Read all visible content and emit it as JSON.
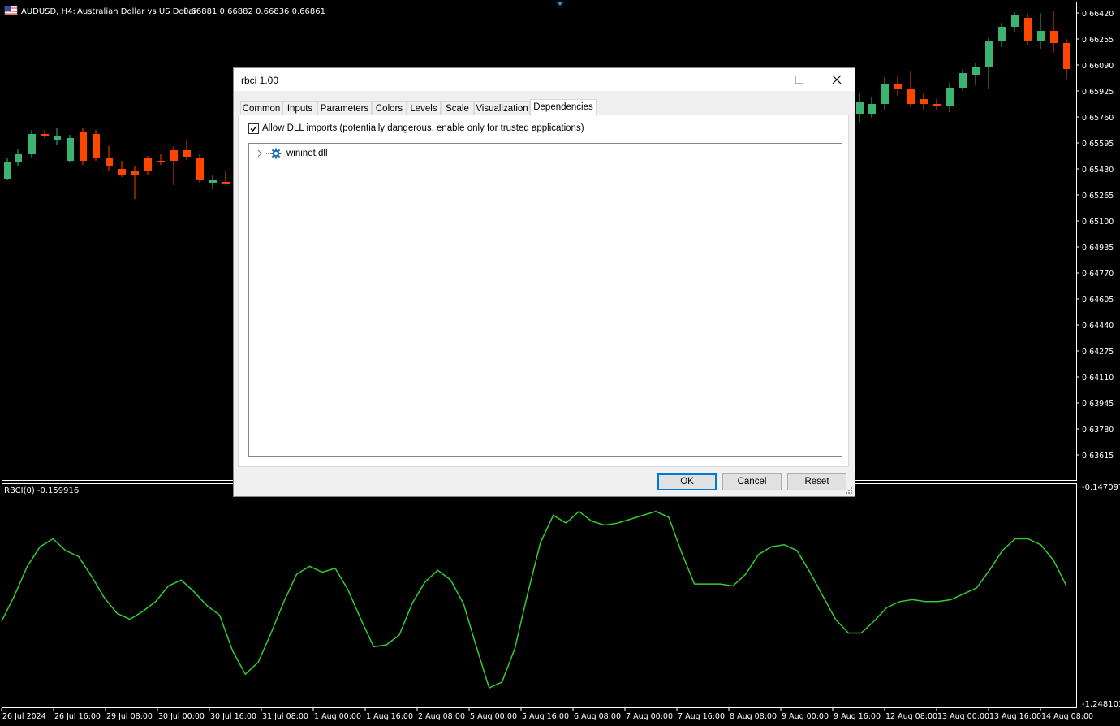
{
  "chart": {
    "header": {
      "symbol": "AUDUSD, H4:",
      "description": "Australian Dollar vs US Dollar",
      "ohlc": "0.66881 0.66882 0.66836 0.66861"
    },
    "price_axis": [
      "0.66420",
      "0.66255",
      "0.66090",
      "0.65925",
      "0.65760",
      "0.65595",
      "0.65430",
      "0.65265",
      "0.65100",
      "0.64935",
      "0.64770",
      "0.64605",
      "0.64440",
      "0.64275",
      "0.64110",
      "0.63945",
      "0.63780",
      "0.63615"
    ],
    "indicator": {
      "label": "RBCI(0) -0.159916",
      "axis_top": "-0.147097",
      "axis_bottom": "-1.248103"
    },
    "time_axis": [
      "26 Jul 2024",
      "26 Jul 16:00",
      "29 Jul 08:00",
      "30 Jul 00:00",
      "30 Jul 16:00",
      "31 Jul 08:00",
      "1 Aug 00:00",
      "1 Aug 16:00",
      "2 Aug 08:00",
      "5 Aug 00:00",
      "5 Aug 16:00",
      "6 Aug 08:00",
      "7 Aug 00:00",
      "7 Aug 16:00",
      "8 Aug 08:00",
      "9 Aug 00:00",
      "9 Aug 16:00",
      "12 Aug 08:00",
      "13 Aug 00:00",
      "13 Aug 16:00",
      "14 Aug 08:00"
    ],
    "colors": {
      "bull": "#3cb371",
      "bear": "#ff4500",
      "indicator_line": "#32cd32",
      "grid": "#ffffff"
    }
  },
  "chart_data": {
    "type": "line",
    "title": "RBCI(0) -0.159916",
    "xlabel": "",
    "ylabel": "",
    "ylim": [
      -1.248103,
      -0.147097
    ],
    "values": [
      -0.83,
      -0.7,
      -0.55,
      -0.45,
      -0.41,
      -0.47,
      -0.5,
      -0.6,
      -0.71,
      -0.79,
      -0.82,
      -0.78,
      -0.73,
      -0.65,
      -0.62,
      -0.68,
      -0.75,
      -0.8,
      -0.98,
      -1.1,
      -1.04,
      -0.89,
      -0.73,
      -0.59,
      -0.55,
      -0.58,
      -0.56,
      -0.67,
      -0.82,
      -0.96,
      -0.95,
      -0.9,
      -0.74,
      -0.63,
      -0.57,
      -0.62,
      -0.74,
      -0.96,
      -1.17,
      -1.14,
      -0.97,
      -0.69,
      -0.43,
      -0.29,
      -0.33,
      -0.27,
      -0.32,
      -0.34,
      -0.33,
      -0.31,
      -0.29,
      -0.27,
      -0.3,
      -0.48,
      -0.64,
      -0.64,
      -0.64,
      -0.65,
      -0.59,
      -0.49,
      -0.45,
      -0.44,
      -0.47,
      -0.58,
      -0.7,
      -0.82,
      -0.89,
      -0.89,
      -0.83,
      -0.76,
      -0.73,
      -0.72,
      -0.73,
      -0.73,
      -0.72,
      -0.69,
      -0.66,
      -0.57,
      -0.47,
      -0.41,
      -0.41,
      -0.44,
      -0.52,
      -0.65
    ]
  },
  "dialog": {
    "title": "rbci 1.00",
    "tabs": [
      "Common",
      "Inputs",
      "Parameters",
      "Colors",
      "Levels",
      "Scale",
      "Visualization",
      "Dependencies"
    ],
    "active_tab": "Dependencies",
    "allow_dll_label": "Allow DLL imports (potentially dangerous, enable only for trusted applications)",
    "allow_dll_checked": true,
    "dependencies": [
      {
        "name": "wininet.dll",
        "icon": "gear-icon"
      }
    ],
    "buttons": {
      "ok": "OK",
      "cancel": "Cancel",
      "reset": "Reset"
    }
  }
}
